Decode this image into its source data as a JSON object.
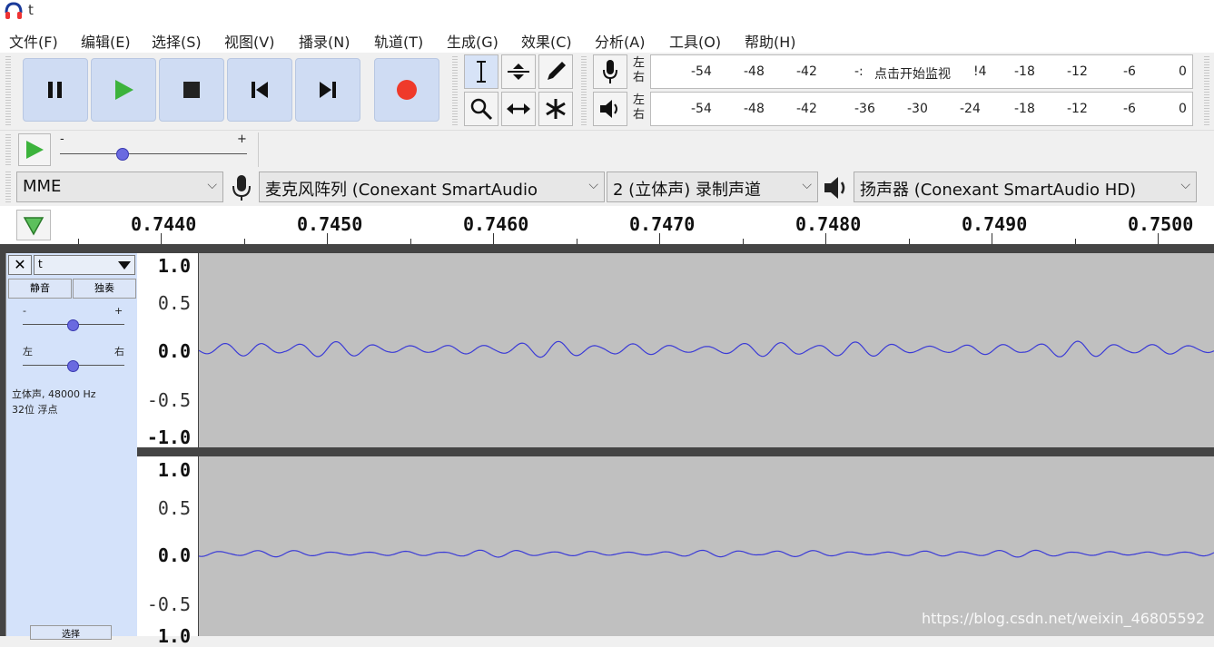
{
  "window": {
    "title": "t"
  },
  "menu": [
    "文件(F)",
    "编辑(E)",
    "选择(S)",
    "视图(V)",
    "播录(N)",
    "轨道(T)",
    "生成(G)",
    "效果(C)",
    "分析(A)",
    "工具(O)",
    "帮助(H)"
  ],
  "meters": {
    "rec_lr": [
      "左",
      "右"
    ],
    "play_lr": [
      "左",
      "右"
    ],
    "rec_ticks": [
      "-54",
      "-48",
      "-42",
      "-:",
      "!4",
      "-18",
      "-12",
      "-6",
      "0"
    ],
    "rec_overlay": "点击开始监视",
    "play_ticks": [
      "-54",
      "-48",
      "-42",
      "-36",
      "-30",
      "-24",
      "-18",
      "-12",
      "-6",
      "0"
    ]
  },
  "speed": {
    "minus": "-",
    "plus": "+"
  },
  "devices": {
    "host": "MME",
    "mic": "麦克风阵列 (Conexant SmartAudio",
    "channels": "2 (立体声) 录制声道",
    "speaker": "扬声器 (Conexant SmartAudio HD)"
  },
  "ruler": {
    "labels": [
      "0.7440",
      "0.7450",
      "0.7460",
      "0.7470",
      "0.7480",
      "0.7490",
      "0.7500"
    ]
  },
  "track": {
    "name": "t",
    "mute": "静音",
    "solo": "独奏",
    "gain_minus": "-",
    "gain_plus": "+",
    "pan_left": "左",
    "pan_right": "右",
    "info1": "立体声, 48000 Hz",
    "info2": "32位 浮点",
    "collapse": "选择"
  },
  "vscale1": [
    "1.0",
    "0.5",
    "0.0",
    "-0.5",
    "-1.0"
  ],
  "vscale2": [
    "1.0",
    "0.5",
    "0.0",
    "-0.5",
    "1.0"
  ],
  "watermark": "https://blog.csdn.net/weixin_46805592",
  "colors": {
    "accent_button": "#cfdcf3",
    "record": "#ef3a2a",
    "play": "#3cb33c",
    "waveform": "#3b3bd6",
    "track_bg": "#c0c0c0"
  }
}
